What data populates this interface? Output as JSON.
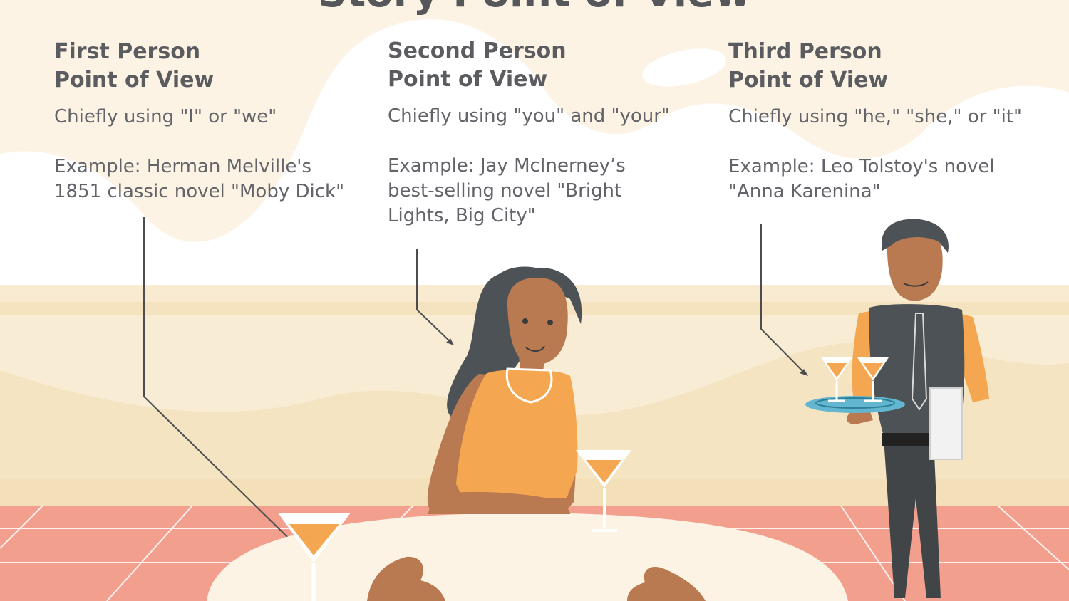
{
  "title": "Story Point of View",
  "columns": [
    {
      "heading_line1": "First Person",
      "heading_line2": "Point of View",
      "usage": "Chiefly using \"I\" or \"we\"",
      "example_line1": "Example: Herman Melville's",
      "example_line2": "1851 classic novel \"Moby Dick\"",
      "example_line3": ""
    },
    {
      "heading_line1": "Second Person",
      "heading_line2": "Point of View",
      "usage": "Chiefly using \"you\" and \"your\"",
      "example_line1": "Example: Jay McInerney’s",
      "example_line2": "best-selling novel \"Bright",
      "example_line3": "Lights, Big City\""
    },
    {
      "heading_line1": "Third Person",
      "heading_line2": "Point of View",
      "usage": "Chiefly using \"he,\" \"she,\" or \"it\"",
      "example_line1": "Example: Leo Tolstoy's novel",
      "example_line2": "\"Anna Karenina\"",
      "example_line3": ""
    }
  ],
  "colors": {
    "background": "#fdf3e4",
    "wall": "#f5e6c6",
    "floor": "#f29f8e",
    "accent_orange": "#f5a650",
    "text": "#5f6064",
    "pointer": "#4d4d4f"
  },
  "illustrations": [
    "woman-seated-icon",
    "waiter-icon",
    "martini-glass-icon",
    "table-icon",
    "hands-icon"
  ]
}
